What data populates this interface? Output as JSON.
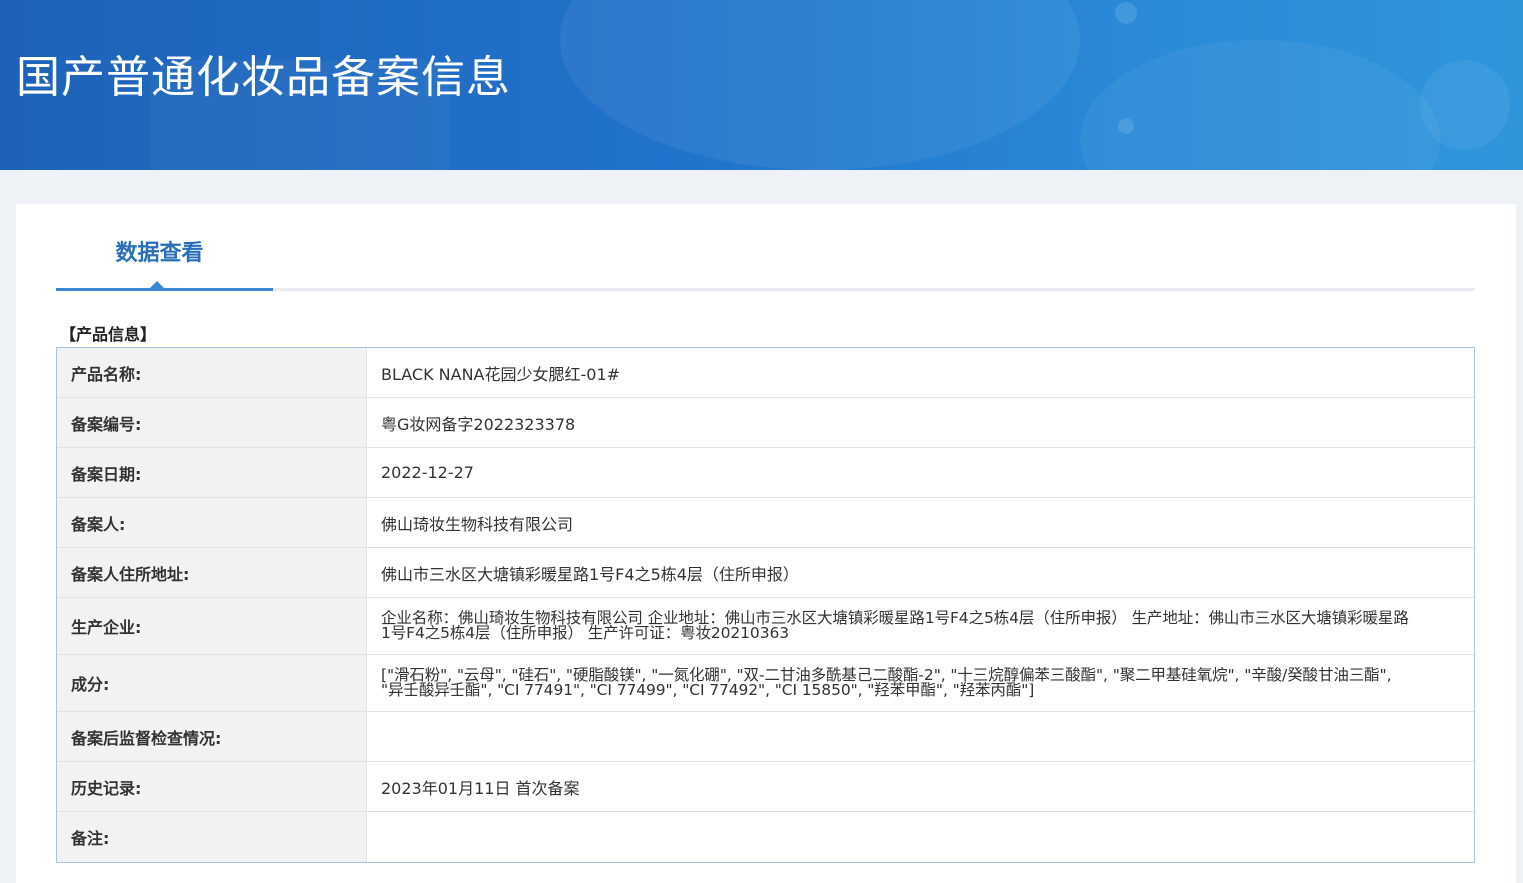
{
  "banner": {
    "title": "国产普通化妆品备案信息"
  },
  "tabs": [
    {
      "label": "数据查看"
    }
  ],
  "section": {
    "title": "【产品信息】"
  },
  "rows": [
    {
      "label": "产品名称:",
      "value": "BLACK NANA花园少女腮红-01#"
    },
    {
      "label": "备案编号:",
      "value": "粤G妆网备字2022323378"
    },
    {
      "label": "备案日期:",
      "value": "2022-12-27"
    },
    {
      "label": "备案人:",
      "value": "佛山琦妆生物科技有限公司"
    },
    {
      "label": "备案人住所地址:",
      "value": "佛山市三水区大塘镇彩暖星路1号F4之5栋4层（住所申报）"
    },
    {
      "label": "生产企业:",
      "value": "企业名称：佛山琦妆生物科技有限公司 企业地址：佛山市三水区大塘镇彩暖星路1号F4之5栋4层（住所申报） 生产地址：佛山市三水区大塘镇彩暖星路1号F4之5栋4层（住所申报） 生产许可证：粤妆20210363"
    },
    {
      "label": "成分:",
      "value": "[\"滑石粉\", \"云母\", \"硅石\", \"硬脂酸镁\", \"一氮化硼\", \"双-二甘油多酰基己二酸酯-2\", \"十三烷醇偏苯三酸酯\", \"聚二甲基硅氧烷\", \"辛酸/癸酸甘油三酯\", \"异壬酸异壬酯\", \"CI 77491\", \"CI 77499\", \"CI 77492\", \"CI 15850\", \"羟苯甲酯\", \"羟苯丙酯\"]"
    },
    {
      "label": "备案后监督检查情况:",
      "value": ""
    },
    {
      "label": "历史记录:",
      "value": "2023年01月11日 首次备案"
    },
    {
      "label": "备注:",
      "value": ""
    }
  ],
  "colors": {
    "banner_blue": "#1d62b8",
    "tab_accent": "#3b86d6",
    "tab_text": "#2a6fb8",
    "label_bg": "#f2f2f2",
    "table_border": "#a9c4e3"
  }
}
